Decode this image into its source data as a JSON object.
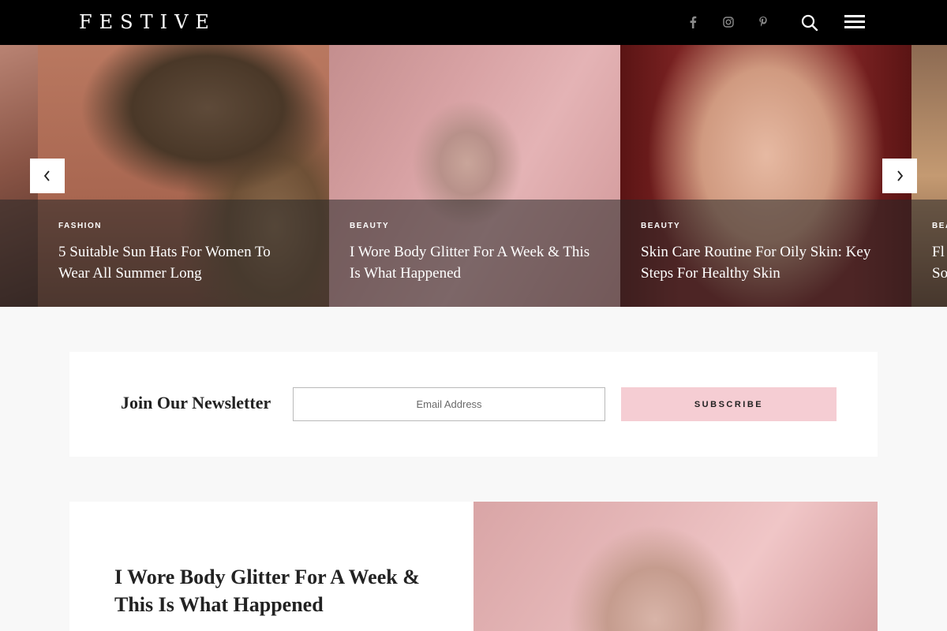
{
  "header": {
    "logo": "FESTIVE",
    "social": [
      "facebook-icon",
      "instagram-icon",
      "pinterest-icon"
    ],
    "search_icon": "search-icon",
    "menu_icon": "hamburger-menu-icon"
  },
  "slider": {
    "prev_icon": "chevron-left-icon",
    "next_icon": "chevron-right-icon",
    "slides": [
      {
        "category": "FASHION",
        "title": "5 Suitable Sun Hats For Women To Wear All Summer Long"
      },
      {
        "category": "BEAUTY",
        "title": "I Wore Body Glitter For A Week & This Is What Happened"
      },
      {
        "category": "BEAUTY",
        "title": "Skin Care Routine For Oily Skin: Key Steps For Healthy Skin"
      },
      {
        "category": "BEA",
        "title": "Fl So"
      }
    ]
  },
  "newsletter": {
    "heading": "Join Our Newsletter",
    "email_placeholder": "Email Address",
    "subscribe_label": "SUBSCRIBE"
  },
  "featured": {
    "title": "I Wore Body Glitter For A Week & This Is What Happened"
  },
  "colors": {
    "header_bg": "#000000",
    "page_bg": "#f8f8f8",
    "subscribe_bg": "#f5cdd3"
  }
}
